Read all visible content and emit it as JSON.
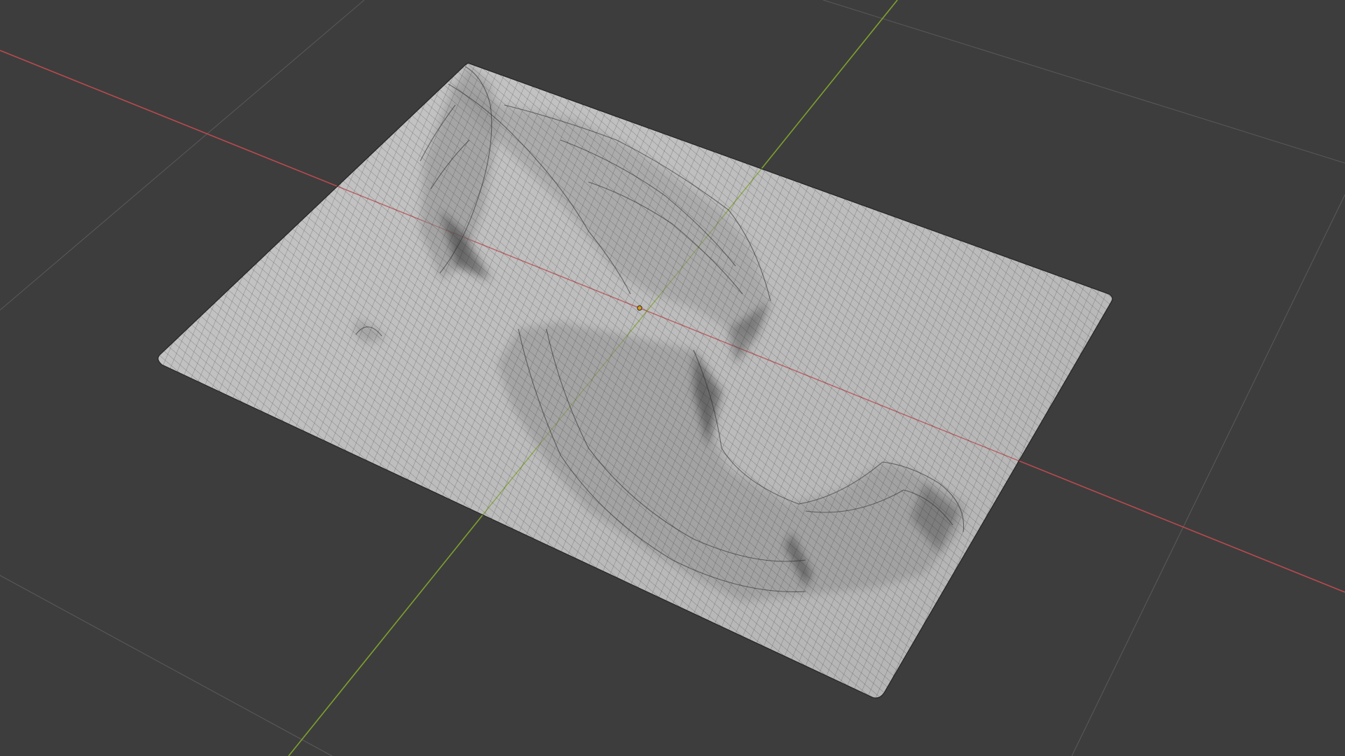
{
  "viewport": {
    "background_color": "#3d3d3d",
    "grid_line_color": "#5a5a5a",
    "x_axis_color": "#b84a4f",
    "y_axis_color": "#7ea12e",
    "mesh_fill_color": "#bdbdbd",
    "mesh_wire_color": "#262626",
    "origin_color": "#d79a1e",
    "view": "perspective",
    "shading": "solid",
    "overlay": "wireframe"
  },
  "object": {
    "name": "",
    "type": "terrain-plane",
    "selected": false
  },
  "icons": {
    "origin": "object-origin-icon"
  }
}
